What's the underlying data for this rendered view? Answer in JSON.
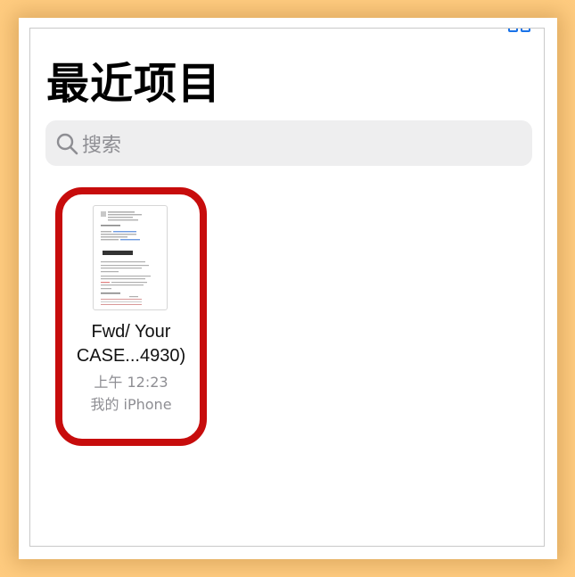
{
  "header": {
    "title": "最近项目"
  },
  "search": {
    "placeholder": "搜索"
  },
  "files": [
    {
      "name_line1": "Fwd/ Your",
      "name_line2": "CASE...4930)",
      "time": "上午 12:23",
      "location": "我的 iPhone"
    }
  ],
  "colors": {
    "background": "#ffcc80",
    "highlight": "#c70c0c",
    "accent": "#1a73e8",
    "search_bg": "#eeeeef",
    "secondary_text": "#8e8e93"
  }
}
